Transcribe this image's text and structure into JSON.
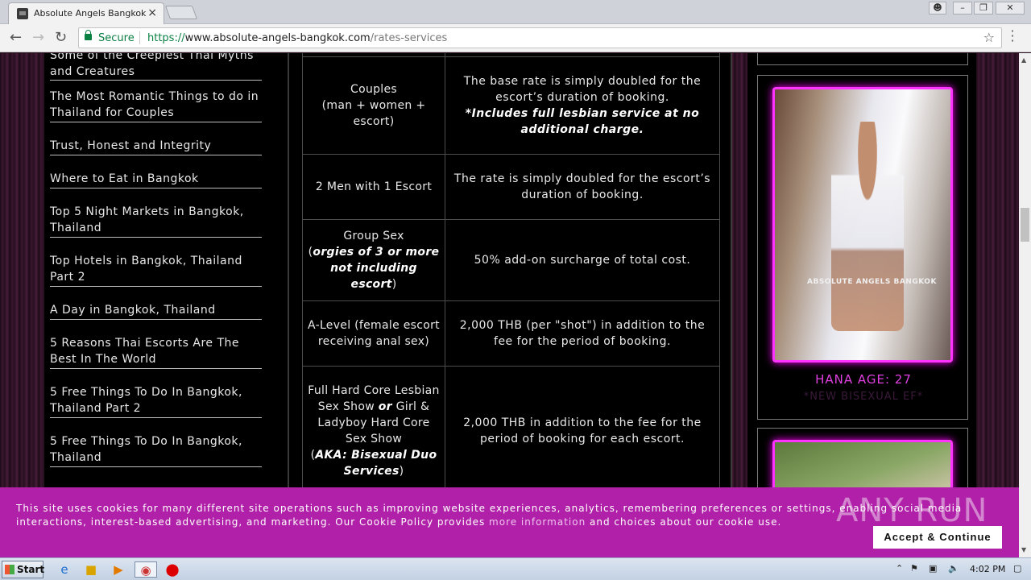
{
  "browser": {
    "tab_title": "Absolute Angels Bangkok - A",
    "tab_close": "×",
    "secure_label": "Secure",
    "url_scheme": "https://",
    "url_host": "www.absolute-angels-bangkok.com",
    "url_path": "/rates-services"
  },
  "sidebar": {
    "items": [
      {
        "label": "Some of the Creepiest Thai Myths and Creatures"
      },
      {
        "label": "The Most Romantic Things to do in Thailand for Couples"
      },
      {
        "label": "Trust, Honest and Integrity"
      },
      {
        "label": "Where to Eat in Bangkok"
      },
      {
        "label": "Top 5 Night Markets in Bangkok, Thailand"
      },
      {
        "label": "Top Hotels in Bangkok, Thailand Part 2"
      },
      {
        "label": "A Day in Bangkok, Thailand"
      },
      {
        "label": "5 Reasons Thai Escorts Are The Best In The World"
      },
      {
        "label": "5 Free Things To Do In Bangkok, Thailand Part 2"
      },
      {
        "label": "5 Free Things To Do In Bangkok, Thailand"
      }
    ]
  },
  "rates_table": {
    "rows": [
      {
        "service_a": "Couples",
        "service_b": "(man + women + escort)",
        "desc_a": "The base rate is simply doubled for the escort’s duration of booking.",
        "desc_b": "*Includes full lesbian service at no additional charge."
      },
      {
        "service_a": "2 Men with 1 Escort",
        "desc_a": "The rate is simply doubled for the escort’s duration of booking."
      },
      {
        "service_a": "Group Sex",
        "service_b": "orgies of 3 or more not including escort",
        "desc_a": "50% add-on surcharge of total cost."
      },
      {
        "service_a": "A-Level (female escort receiving anal sex)",
        "desc_a": "2,000 THB (per \"shot\") in addition to the fee for the period of booking."
      },
      {
        "service_a": "Full Hard Core Lesbian Sex Show",
        "service_or": "or",
        "service_c": "Girl & Ladyboy Hard Core Sex Show",
        "service_d": "AKA: Bisexual Duo Services",
        "desc_a": "2,000 THB in addition to the fee for the period of booking for each escort."
      }
    ]
  },
  "profiles": [
    {
      "watermark": "ABSOLUTE ANGELS BANGKOK",
      "name": "HANA AGE: 27",
      "desc": "*NEW BISEXUAL EF*"
    }
  ],
  "cookie_banner": {
    "text_a": "This site uses cookies for many different site operations such as improving website experiences, analytics, remembering preferences or settings, enabling social media interactions, interest-based advertising, and marketing. Our Cookie Policy provides",
    "link": "more information",
    "text_b": "and choices about our cookie use.",
    "accept_label": "Accept & Continue",
    "watermark": "ANY RUN"
  },
  "taskbar": {
    "start_label": "Start",
    "clock": "4:02 PM"
  },
  "colors": {
    "accent_pink": "#ff33ff",
    "cookie_bg": "#b020a8",
    "secure_green": "#0b8043"
  }
}
